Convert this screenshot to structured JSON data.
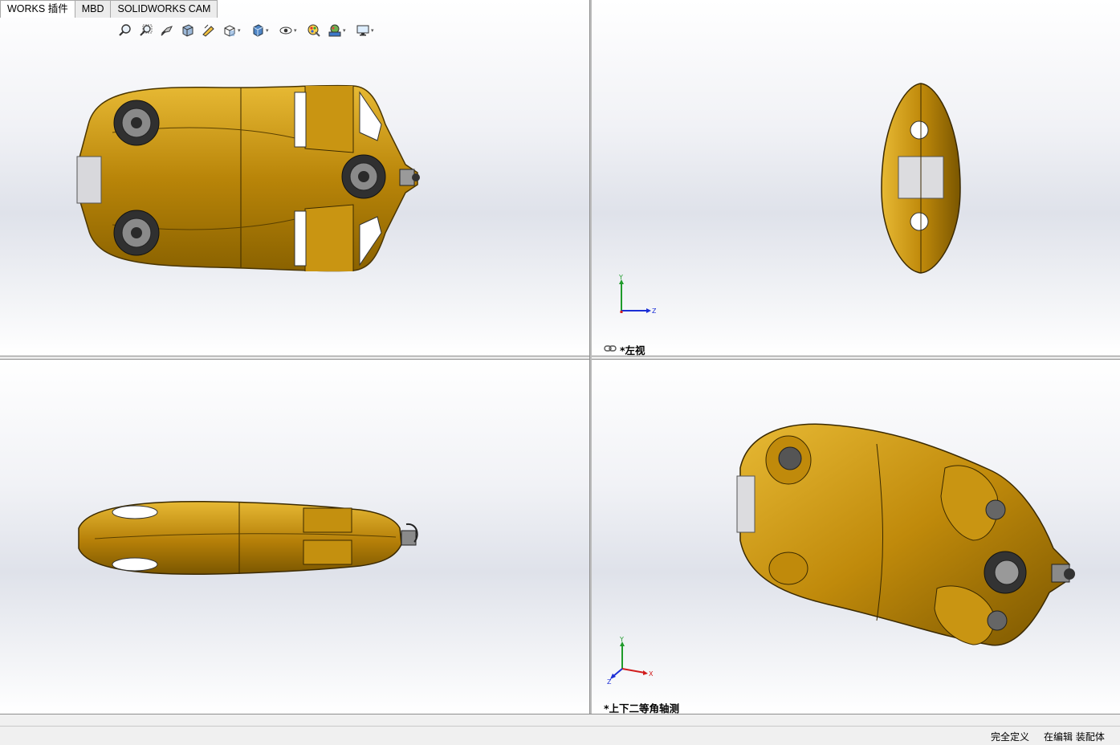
{
  "tabs": [
    {
      "label": "WORKS 插件",
      "active": true
    },
    {
      "label": "MBD",
      "active": false
    },
    {
      "label": "SOLIDWORKS CAM",
      "active": false
    }
  ],
  "toolbar": {
    "icons": [
      "zoom-to-fit-icon",
      "zoom-to-area-icon",
      "previous-view-icon",
      "section-view-icon",
      "dynamic-annotation-icon",
      "view-orientation-icon",
      "display-style-icon",
      "hide-show-items-icon",
      "edit-appearance-icon",
      "apply-scene-icon",
      "view-settings-icon"
    ]
  },
  "viewports": {
    "top_left": {
      "label": ""
    },
    "top_right": {
      "label": "*左视",
      "axes": {
        "y": "Y",
        "z": "Z"
      }
    },
    "bottom_left": {
      "label": ""
    },
    "bottom_right": {
      "label": "*上下二等角轴测",
      "axes": {
        "y": "Y",
        "x": "X",
        "z": "Z"
      }
    }
  },
  "status_bar": {
    "definition": "完全定义",
    "mode": "在编辑 装配体"
  },
  "colors": {
    "body_gold": "#c9950f",
    "body_dark": "#7a5600",
    "body_light": "#e7b934",
    "axis_y": "#1f9b2a",
    "axis_z": "#1c2fd6",
    "axis_x": "#d11d1d"
  }
}
